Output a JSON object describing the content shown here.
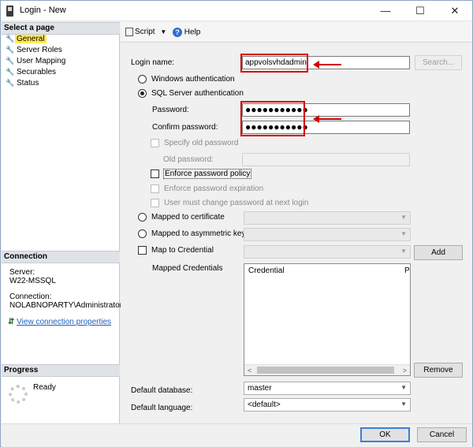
{
  "window": {
    "title": "Login - New",
    "controls": {
      "minimize": "—",
      "maximize": "☐",
      "close": "✕"
    }
  },
  "sidebar": {
    "select_page_header": "Select a page",
    "pages": [
      {
        "label": "General",
        "selected": true
      },
      {
        "label": "Server Roles"
      },
      {
        "label": "User Mapping"
      },
      {
        "label": "Securables"
      },
      {
        "label": "Status"
      }
    ],
    "connection": {
      "header": "Connection",
      "server_label": "Server:",
      "server_value": "W22-MSSQL",
      "connection_label": "Connection:",
      "connection_value": "NOLABNOPARTY\\Administrator",
      "link": "View connection properties"
    },
    "progress": {
      "header": "Progress",
      "status": "Ready"
    }
  },
  "toolbar": {
    "script_label": "Script",
    "help_label": "Help"
  },
  "form": {
    "login_name_label": "Login name:",
    "login_name_value": "appvolsvhdadmin",
    "search_button": "Search...",
    "windows_auth": "Windows authentication",
    "sql_auth": "SQL Server authentication",
    "password_label": "Password:",
    "password_value": "●●●●●●●●●●●",
    "confirm_password_label": "Confirm password:",
    "confirm_password_value": "●●●●●●●●●●●",
    "specify_old_password": "Specify old password",
    "old_password_label": "Old password:",
    "enforce_policy": "Enforce password policy",
    "enforce_expiration": "Enforce password expiration",
    "must_change": "User must change password at next login",
    "mapped_certificate": "Mapped to certificate",
    "mapped_asym_key": "Mapped to asymmetric key",
    "map_credential": "Map to Credential",
    "add_button": "Add",
    "mapped_credentials_label": "Mapped Credentials",
    "credentials_columns": [
      "Credential",
      "P"
    ],
    "remove_button": "Remove",
    "default_database_label": "Default database:",
    "default_database_value": "master",
    "default_language_label": "Default language:",
    "default_language_value": "<default>"
  },
  "footer": {
    "ok_button": "OK",
    "cancel_button": "Cancel"
  },
  "colors": {
    "highlight": "#ffea55",
    "annotation_red": "#d40000",
    "link_blue": "#1f5fbf",
    "default_button_border": "#3c7fd6"
  }
}
